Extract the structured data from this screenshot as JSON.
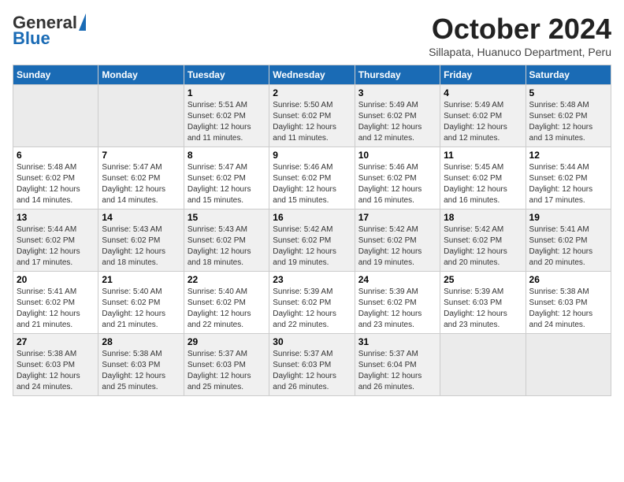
{
  "logo": {
    "general": "General",
    "blue": "Blue"
  },
  "title": "October 2024",
  "location": "Sillapata, Huanuco Department, Peru",
  "days_of_week": [
    "Sunday",
    "Monday",
    "Tuesday",
    "Wednesday",
    "Thursday",
    "Friday",
    "Saturday"
  ],
  "weeks": [
    [
      {
        "day": "",
        "empty": true
      },
      {
        "day": "",
        "empty": true
      },
      {
        "day": "1",
        "sunrise": "Sunrise: 5:51 AM",
        "sunset": "Sunset: 6:02 PM",
        "daylight": "Daylight: 12 hours and 11 minutes."
      },
      {
        "day": "2",
        "sunrise": "Sunrise: 5:50 AM",
        "sunset": "Sunset: 6:02 PM",
        "daylight": "Daylight: 12 hours and 11 minutes."
      },
      {
        "day": "3",
        "sunrise": "Sunrise: 5:49 AM",
        "sunset": "Sunset: 6:02 PM",
        "daylight": "Daylight: 12 hours and 12 minutes."
      },
      {
        "day": "4",
        "sunrise": "Sunrise: 5:49 AM",
        "sunset": "Sunset: 6:02 PM",
        "daylight": "Daylight: 12 hours and 12 minutes."
      },
      {
        "day": "5",
        "sunrise": "Sunrise: 5:48 AM",
        "sunset": "Sunset: 6:02 PM",
        "daylight": "Daylight: 12 hours and 13 minutes."
      }
    ],
    [
      {
        "day": "6",
        "sunrise": "Sunrise: 5:48 AM",
        "sunset": "Sunset: 6:02 PM",
        "daylight": "Daylight: 12 hours and 14 minutes."
      },
      {
        "day": "7",
        "sunrise": "Sunrise: 5:47 AM",
        "sunset": "Sunset: 6:02 PM",
        "daylight": "Daylight: 12 hours and 14 minutes."
      },
      {
        "day": "8",
        "sunrise": "Sunrise: 5:47 AM",
        "sunset": "Sunset: 6:02 PM",
        "daylight": "Daylight: 12 hours and 15 minutes."
      },
      {
        "day": "9",
        "sunrise": "Sunrise: 5:46 AM",
        "sunset": "Sunset: 6:02 PM",
        "daylight": "Daylight: 12 hours and 15 minutes."
      },
      {
        "day": "10",
        "sunrise": "Sunrise: 5:46 AM",
        "sunset": "Sunset: 6:02 PM",
        "daylight": "Daylight: 12 hours and 16 minutes."
      },
      {
        "day": "11",
        "sunrise": "Sunrise: 5:45 AM",
        "sunset": "Sunset: 6:02 PM",
        "daylight": "Daylight: 12 hours and 16 minutes."
      },
      {
        "day": "12",
        "sunrise": "Sunrise: 5:44 AM",
        "sunset": "Sunset: 6:02 PM",
        "daylight": "Daylight: 12 hours and 17 minutes."
      }
    ],
    [
      {
        "day": "13",
        "sunrise": "Sunrise: 5:44 AM",
        "sunset": "Sunset: 6:02 PM",
        "daylight": "Daylight: 12 hours and 17 minutes."
      },
      {
        "day": "14",
        "sunrise": "Sunrise: 5:43 AM",
        "sunset": "Sunset: 6:02 PM",
        "daylight": "Daylight: 12 hours and 18 minutes."
      },
      {
        "day": "15",
        "sunrise": "Sunrise: 5:43 AM",
        "sunset": "Sunset: 6:02 PM",
        "daylight": "Daylight: 12 hours and 18 minutes."
      },
      {
        "day": "16",
        "sunrise": "Sunrise: 5:42 AM",
        "sunset": "Sunset: 6:02 PM",
        "daylight": "Daylight: 12 hours and 19 minutes."
      },
      {
        "day": "17",
        "sunrise": "Sunrise: 5:42 AM",
        "sunset": "Sunset: 6:02 PM",
        "daylight": "Daylight: 12 hours and 19 minutes."
      },
      {
        "day": "18",
        "sunrise": "Sunrise: 5:42 AM",
        "sunset": "Sunset: 6:02 PM",
        "daylight": "Daylight: 12 hours and 20 minutes."
      },
      {
        "day": "19",
        "sunrise": "Sunrise: 5:41 AM",
        "sunset": "Sunset: 6:02 PM",
        "daylight": "Daylight: 12 hours and 20 minutes."
      }
    ],
    [
      {
        "day": "20",
        "sunrise": "Sunrise: 5:41 AM",
        "sunset": "Sunset: 6:02 PM",
        "daylight": "Daylight: 12 hours and 21 minutes."
      },
      {
        "day": "21",
        "sunrise": "Sunrise: 5:40 AM",
        "sunset": "Sunset: 6:02 PM",
        "daylight": "Daylight: 12 hours and 21 minutes."
      },
      {
        "day": "22",
        "sunrise": "Sunrise: 5:40 AM",
        "sunset": "Sunset: 6:02 PM",
        "daylight": "Daylight: 12 hours and 22 minutes."
      },
      {
        "day": "23",
        "sunrise": "Sunrise: 5:39 AM",
        "sunset": "Sunset: 6:02 PM",
        "daylight": "Daylight: 12 hours and 22 minutes."
      },
      {
        "day": "24",
        "sunrise": "Sunrise: 5:39 AM",
        "sunset": "Sunset: 6:02 PM",
        "daylight": "Daylight: 12 hours and 23 minutes."
      },
      {
        "day": "25",
        "sunrise": "Sunrise: 5:39 AM",
        "sunset": "Sunset: 6:03 PM",
        "daylight": "Daylight: 12 hours and 23 minutes."
      },
      {
        "day": "26",
        "sunrise": "Sunrise: 5:38 AM",
        "sunset": "Sunset: 6:03 PM",
        "daylight": "Daylight: 12 hours and 24 minutes."
      }
    ],
    [
      {
        "day": "27",
        "sunrise": "Sunrise: 5:38 AM",
        "sunset": "Sunset: 6:03 PM",
        "daylight": "Daylight: 12 hours and 24 minutes."
      },
      {
        "day": "28",
        "sunrise": "Sunrise: 5:38 AM",
        "sunset": "Sunset: 6:03 PM",
        "daylight": "Daylight: 12 hours and 25 minutes."
      },
      {
        "day": "29",
        "sunrise": "Sunrise: 5:37 AM",
        "sunset": "Sunset: 6:03 PM",
        "daylight": "Daylight: 12 hours and 25 minutes."
      },
      {
        "day": "30",
        "sunrise": "Sunrise: 5:37 AM",
        "sunset": "Sunset: 6:03 PM",
        "daylight": "Daylight: 12 hours and 26 minutes."
      },
      {
        "day": "31",
        "sunrise": "Sunrise: 5:37 AM",
        "sunset": "Sunset: 6:04 PM",
        "daylight": "Daylight: 12 hours and 26 minutes."
      },
      {
        "day": "",
        "empty": true
      },
      {
        "day": "",
        "empty": true
      }
    ]
  ]
}
